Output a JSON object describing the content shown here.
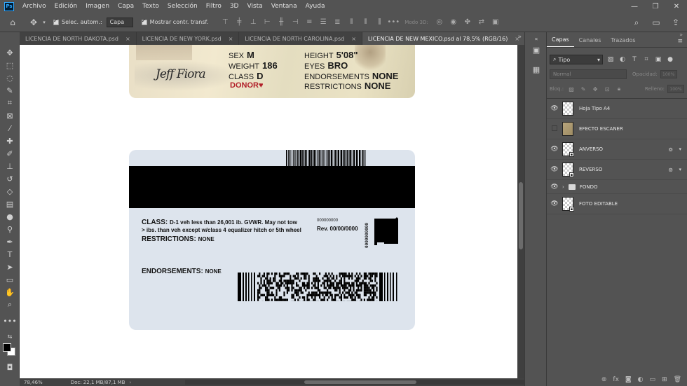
{
  "app": {
    "logo": "Ps",
    "menu": [
      "Archivo",
      "Edición",
      "Imagen",
      "Capa",
      "Texto",
      "Selección",
      "Filtro",
      "3D",
      "Vista",
      "Ventana",
      "Ayuda"
    ],
    "window_controls": [
      "—",
      "❐",
      "✕"
    ]
  },
  "options_bar": {
    "auto_select_label": "Selec. autom.:",
    "auto_select_value": "Capa",
    "show_transform_label": "Mostrar contr. transf.",
    "mode_3d_label": "Modo 3D:"
  },
  "tabs": [
    {
      "label": "LICENCIA DE NORTH DAKOTA.psd",
      "active": false
    },
    {
      "label": "LICENCIA DE NEW YORK.psd",
      "active": false
    },
    {
      "label": "LICENCIA DE NORTH CAROLINA.psd",
      "active": false
    },
    {
      "label": "LICENCIA DE NEW MEXICO.psd al 78,5% (RGB/16)",
      "active": true
    }
  ],
  "front_card": {
    "sex_label": "SEX",
    "sex_value": "M",
    "weight_label": "WEIGHT",
    "weight_value": "186",
    "class_label": "CLASS",
    "class_value": "D",
    "height_label": "HEIGHT",
    "height_value": "5'08\"",
    "eyes_label": "EYES",
    "eyes_value": "BRO",
    "endorsements_label": "ENDORSEMENTS",
    "endorsements_value": "NONE",
    "restrictions_label": "RESTRICTIONS",
    "restrictions_value": "NONE",
    "signature": "Jeff Fiora",
    "donor_label": "DONOR♥"
  },
  "back_card": {
    "class_label": "CLASS:",
    "class_text_1": "D-1 veh less than 26,001 ib. GVWR. May not tow",
    "class_text_2": "> ibs. than veh except w/class 4 equalizer hitch or 5th wheel",
    "restrictions_label": "RESTRICTIONS:",
    "restrictions_value": "NONE",
    "endorsements_label": "ENDORSEMENTS:",
    "endorsements_value": "NONE",
    "number_small": "000000000",
    "rev_text": "Rev. 00/00/0000",
    "vertical_number": "0000000000"
  },
  "status_bar": {
    "zoom": "78,46%",
    "doc": "Doc: 22,1 MB/87,1 MB"
  },
  "layers_panel": {
    "tabs": [
      "Capas",
      "Canales",
      "Trazados"
    ],
    "filter_label": "Tipo",
    "blend_mode": "Normal",
    "opacity_label": "Opacidad:",
    "opacity_value": "100%",
    "lock_label": "Bloq.:",
    "fill_label": "Relleno:",
    "fill_value": "100%",
    "layers": [
      {
        "name": "Hoja Tipo A4",
        "visible": true,
        "thumb": "transparent"
      },
      {
        "name": "EFECTO ESCANER",
        "visible": false,
        "thumb": "scan"
      },
      {
        "name": "ANVERSO",
        "visible": true,
        "thumb": "smart"
      },
      {
        "name": "REVERSO",
        "visible": true,
        "thumb": "smart"
      },
      {
        "name": "FONDO",
        "visible": true,
        "thumb": "folder"
      },
      {
        "name": "FOTO EDITABLE",
        "visible": true,
        "thumb": "smart"
      }
    ]
  }
}
